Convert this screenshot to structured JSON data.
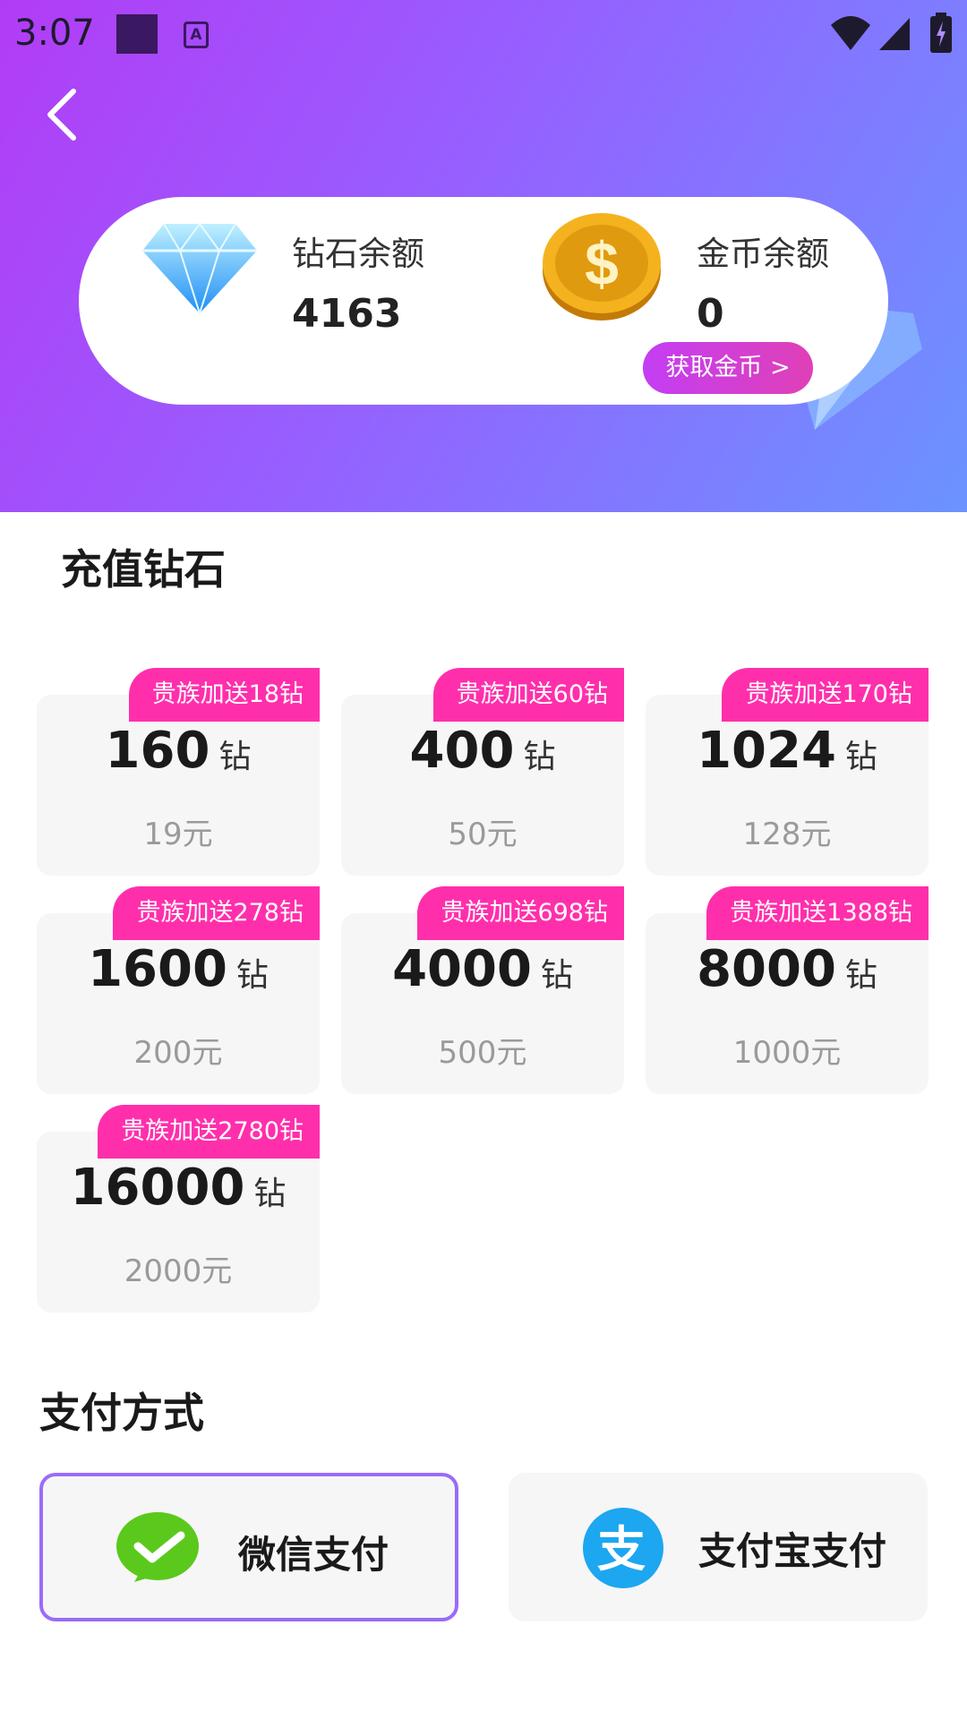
{
  "status": {
    "time": "3:07",
    "app_badge": "A"
  },
  "balance": {
    "diamond_label": "钻石余额",
    "diamond_value": "4163",
    "coin_label": "金币余额",
    "coin_value": "0",
    "get_coin_label": "获取金币 >"
  },
  "recharge": {
    "title": "充值钻石",
    "unit": "钻",
    "packages": [
      {
        "bonus": "贵族加送18钻",
        "amount": "160",
        "price": "19元"
      },
      {
        "bonus": "贵族加送60钻",
        "amount": "400",
        "price": "50元"
      },
      {
        "bonus": "贵族加送170钻",
        "amount": "1024",
        "price": "128元"
      },
      {
        "bonus": "贵族加送278钻",
        "amount": "1600",
        "price": "200元"
      },
      {
        "bonus": "贵族加送698钻",
        "amount": "4000",
        "price": "500元"
      },
      {
        "bonus": "贵族加送1388钻",
        "amount": "8000",
        "price": "1000元"
      },
      {
        "bonus": "贵族加送2780钻",
        "amount": "16000",
        "price": "2000元"
      }
    ]
  },
  "payment": {
    "title": "支付方式",
    "wechat_label": "微信支付",
    "alipay_label": "支付宝支付",
    "selected": "wechat"
  },
  "colors": {
    "accent": "#9a6cf7",
    "badge": "#ff2fac",
    "wechat": "#5ac91c",
    "alipay": "#1ca7f0"
  }
}
